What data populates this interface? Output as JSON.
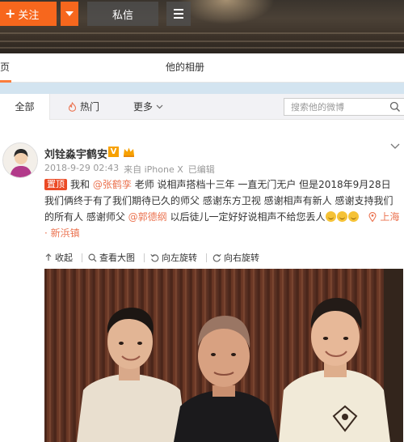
{
  "header": {
    "follow_label": "关注",
    "message_label": "私信"
  },
  "profile_tabs": {
    "home_label": "页",
    "album_label": "他的相册"
  },
  "feed_tabs": {
    "all_label": "全部",
    "hot_label": "热门",
    "more_label": "更多",
    "search_placeholder": "搜索他的微博"
  },
  "post": {
    "author": "刘铨淼宇鹤安",
    "timestamp": "2018-9-29 02:43",
    "source": "来自 iPhone X",
    "edited": "已编辑",
    "pinned_label": "置顶",
    "text_1": "我和",
    "mention_1": "@张鹤孪",
    "text_2": "老师 说相声搭档十三年 一直无门无户 但是2018年9月28日 我们俩终于有了我们期待已久的师父 感谢东方卫视 感谢相声有新人 感谢支持我们的所有人 感谢师父",
    "mention_2": "@郭德纲",
    "text_3": "以后徒儿一定好好说相声不给您丢人",
    "location": "上海 · 新浜镇"
  },
  "toolbar": {
    "collapse": "收起",
    "view_large": "查看大图",
    "rotate_left": "向左旋转",
    "rotate_right": "向右旋转"
  },
  "colors": {
    "accent": "#f7671d",
    "link": "#eb7350",
    "pin": "#eb4a25"
  }
}
